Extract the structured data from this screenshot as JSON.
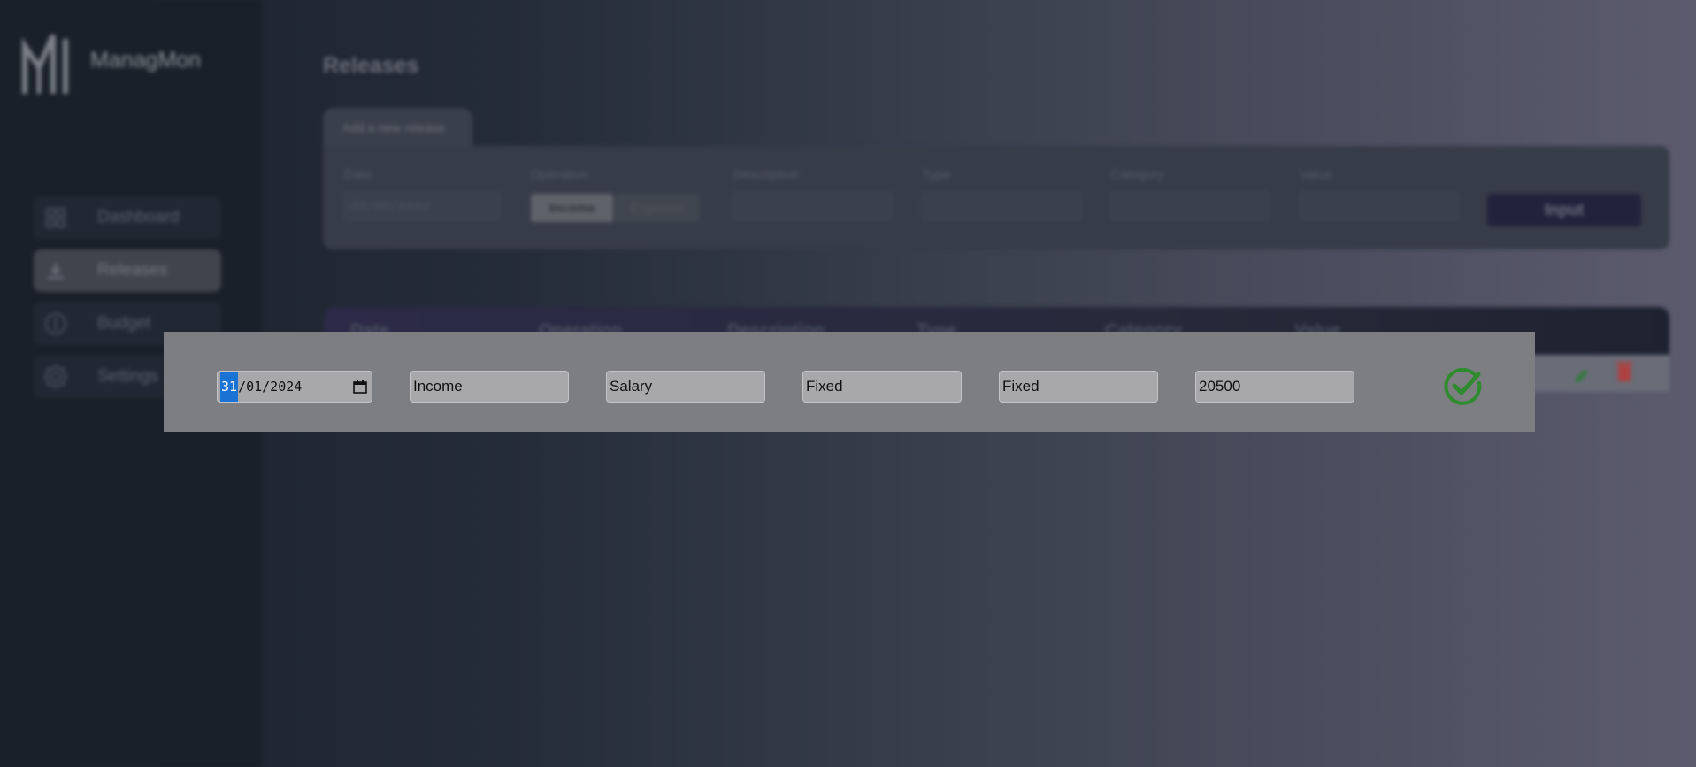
{
  "app": {
    "name": "ManagMon"
  },
  "sidebar": {
    "items": [
      {
        "label": "Dashboard",
        "icon": "dashboard-icon"
      },
      {
        "label": "Releases",
        "icon": "download-icon",
        "active": true
      },
      {
        "label": "Budget",
        "icon": "dollar-icon"
      },
      {
        "label": "Settings",
        "icon": "gear-icon"
      }
    ]
  },
  "page": {
    "title": "Releases"
  },
  "form": {
    "tab_label": "Add a new release",
    "date_label": "Date",
    "date_placeholder": "dd/mm/aaaa",
    "operation_label": "Operation",
    "operation_options": [
      "Income",
      "Expense"
    ],
    "description_label": "Description",
    "type_label": "Type",
    "category_label": "Category",
    "value_label": "Value",
    "submit_label": "Input"
  },
  "table": {
    "headers": [
      "Date",
      "Operation",
      "Description",
      "Type",
      "Category",
      "Value"
    ]
  },
  "edit_row": {
    "date_day": "31",
    "date_rest": "/01/2024",
    "operation": "Income",
    "description": "Salary",
    "type": "Fixed",
    "category": "Fixed",
    "value": "20500",
    "confirm_icon": "check-circle-icon"
  },
  "colors": {
    "confirm_green": "#2e8b2e",
    "accent_button": "#21233d",
    "edit_green": "#2f7a3a",
    "delete_red": "#b04040"
  }
}
